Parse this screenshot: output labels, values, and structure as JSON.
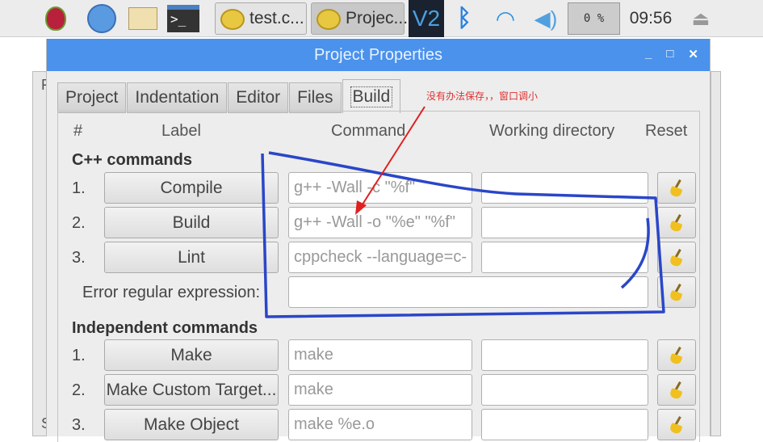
{
  "taskbar": {
    "tasks": [
      {
        "label": "test.c..."
      },
      {
        "label": "Projec..."
      }
    ],
    "cpu": "0 %",
    "clock": "09:56",
    "icons": [
      "raspberry-menu-icon",
      "web-browser-icon",
      "file-manager-icon",
      "terminal-icon",
      "vnc-icon",
      "bluetooth-icon",
      "wifi-icon",
      "volume-icon",
      "eject-icon"
    ]
  },
  "background": {
    "left_letters": [
      "F",
      "S",
      "S"
    ]
  },
  "dialog": {
    "title": "Project Properties",
    "tabs": [
      "Project",
      "Indentation",
      "Editor",
      "Files",
      "Build"
    ],
    "selected_tab": "Build",
    "headers": {
      "num": "#",
      "label": "Label",
      "command": "Command",
      "workdir": "Working directory",
      "reset": "Reset"
    },
    "cpp_section": "C++ commands",
    "cpp_rows": [
      {
        "num": "1.",
        "label": "Compile",
        "command": "g++ -Wall -c \"%f\"",
        "workdir": ""
      },
      {
        "num": "2.",
        "label": "Build",
        "command": "g++ -Wall -o \"%e\" \"%f\"",
        "workdir": ""
      },
      {
        "num": "3.",
        "label": "Lint",
        "command": "cppcheck --language=c-",
        "workdir": ""
      }
    ],
    "error_label": "Error regular expression:",
    "error_value": "",
    "indep_section": "Independent commands",
    "indep_rows": [
      {
        "num": "1.",
        "label": "Make",
        "command": "make",
        "workdir": ""
      },
      {
        "num": "2.",
        "label": "Make Custom Target...",
        "command": "make",
        "workdir": ""
      },
      {
        "num": "3.",
        "label": "Make Object",
        "command": "make %e.o",
        "workdir": ""
      }
    ]
  },
  "annotation": {
    "note": "没有办法保存，，窗口调小",
    "colors": {
      "pen": "#2a46c8",
      "arrow": "#e02020"
    }
  }
}
